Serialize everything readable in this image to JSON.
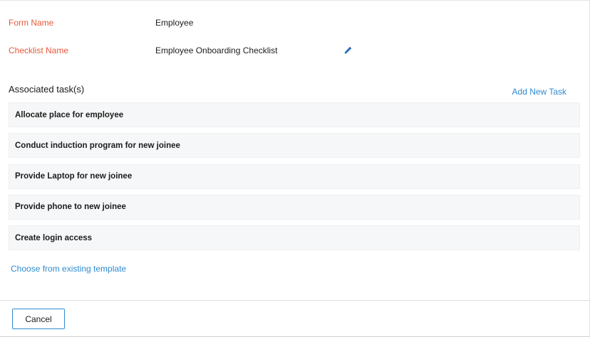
{
  "form": {
    "form_name_label": "Form Name",
    "form_name_value": "Employee",
    "checklist_name_label": "Checklist Name",
    "checklist_name_value": "Employee Onboarding Checklist",
    "edit_icon": "pencil-icon"
  },
  "tasks": {
    "heading": "Associated task(s)",
    "add_label": "Add New Task",
    "items": [
      "Allocate place for employee",
      "Conduct induction program for new joinee",
      "Provide Laptop for new joinee",
      "Provide phone to new joinee",
      "Create login access"
    ],
    "template_link": "Choose from existing template"
  },
  "footer": {
    "cancel_label": "Cancel"
  },
  "colors": {
    "label_accent": "#e8593a",
    "link_blue": "#2d8bd0",
    "row_bg": "#f6f7f8"
  }
}
